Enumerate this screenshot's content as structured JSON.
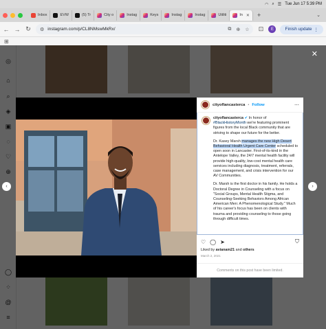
{
  "menubar": {
    "datetime": "Tue Jun 17  5:39 PM"
  },
  "tabs": [
    {
      "label": "Inbox",
      "favicon": "gmail"
    },
    {
      "label": "EVW",
      "favicon": "x"
    },
    {
      "label": "(5) Tr",
      "favicon": "x"
    },
    {
      "label": "City o",
      "favicon": "instagram"
    },
    {
      "label": "Instag",
      "favicon": "instagram"
    },
    {
      "label": "Keys",
      "favicon": "instagram"
    },
    {
      "label": "Instag",
      "favicon": "instagram"
    },
    {
      "label": "Instag",
      "favicon": "instagram"
    },
    {
      "label": "Utiliti",
      "favicon": "instagram"
    },
    {
      "label": "In",
      "favicon": "instagram",
      "active": true
    }
  ],
  "toolbar": {
    "url": "instagram.com/p/CL8NMswMkRx/",
    "profile_initial": "E",
    "finish_update": "Finish update"
  },
  "post": {
    "username": "cityoflancasterca",
    "follow": "Follow",
    "verified_icon": "verified-badge-icon",
    "caption_intro_pre": "In honor of ",
    "caption_hashtag": "#BlackHistoryMonth",
    "caption_intro_post": " we're featuring prominent figures from the local Black community that are striving to shape our future for the better.",
    "p1_pre": "Dr. Kasey Marsh ",
    "p1_highlight": "manages the new High Desert Behavioral Health Urgent Care Center",
    "p1_post": " scheduled to open soon in Lancaster. First-of-its-kind in the Antelope Valley, the 24/7 mental health facility will provide high-quality, low-cost mental health care services including diagnosis, treatment, referrals, case management, and crisis intervention for our AV Communities.",
    "p2": "Dr. Marsh is the first doctor in his family. He holds a Doctoral Degree in Counseling with a focus on \"Social Groups, Mental Health Stigma, and Counseling-Seeking Behaviors Among African American Men: A Phenomenological Study.\" Much of his career's focus has been on clients with trauma and providing counseling to those going through difficult times.",
    "liked_by_label": "Liked by ",
    "liked_by_user": "avianam21",
    "liked_by_and": " and ",
    "liked_by_others": "others",
    "date": "March 2, 2021",
    "comments_limited": "Comments on this post have been limited."
  },
  "colors": {
    "accent_blue": "#0095f6",
    "hashtag_blue": "#00376b",
    "highlight": "#b9d4f5",
    "overlay": "rgba(0,0,0,0.6)"
  }
}
